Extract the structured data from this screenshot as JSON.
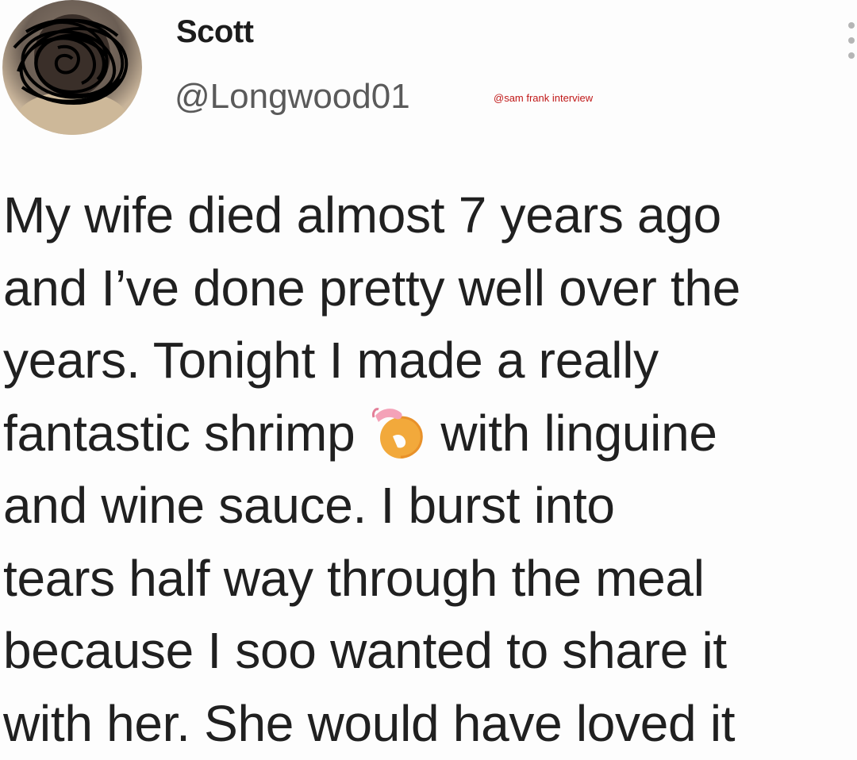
{
  "tweet": {
    "author_name": "Scott",
    "author_handle": "@Longwood01",
    "watermark": "@sam frank interview",
    "avatar_icon": "avatar-scribbled",
    "more_icon": "more-vertical-icon",
    "body_lines": [
      "My wife died almost 7 years ago",
      "and I’ve done pretty well over the",
      "years. Tonight I made a really",
      "fantastic shrimp",
      "with linguine",
      "and wine sauce. I burst into",
      "tears half way through the meal",
      "because I soo wanted to share it",
      "with her. She would have loved it"
    ],
    "emoji": "shrimp-icon"
  }
}
